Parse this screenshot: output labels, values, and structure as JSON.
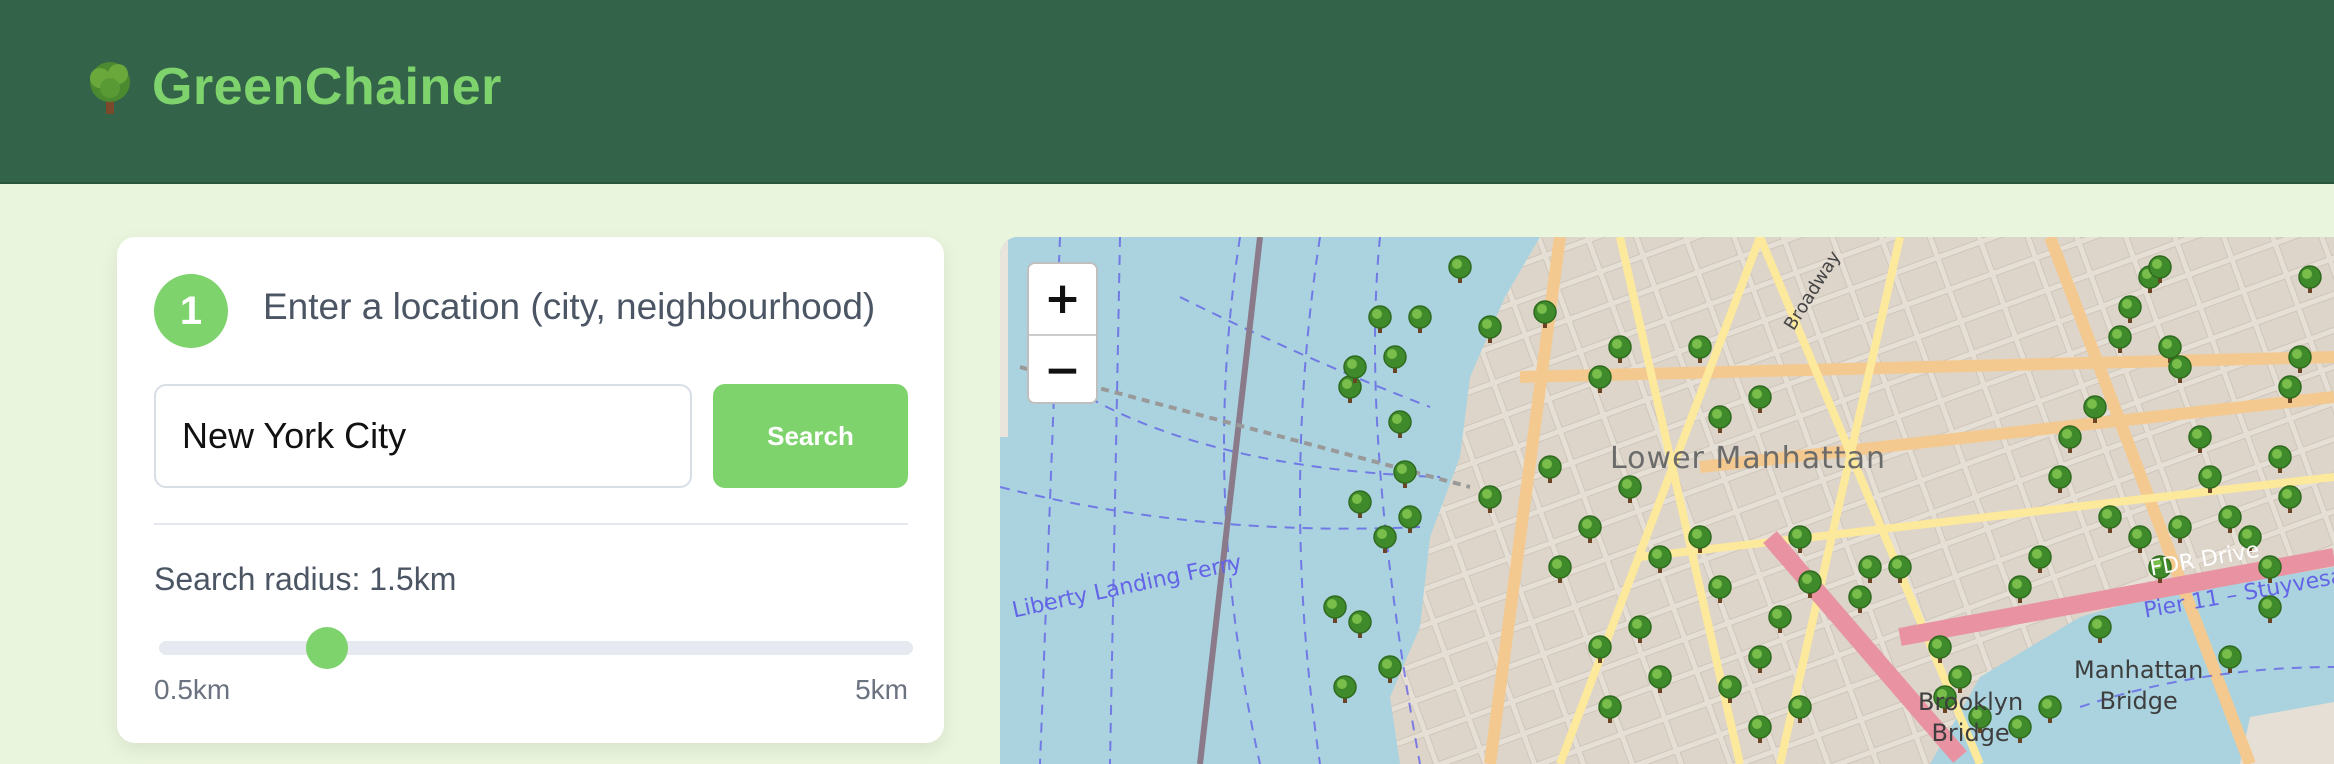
{
  "header": {
    "app_title": "GreenChainer",
    "logo_icon": "tree-icon"
  },
  "location_step": {
    "step_number": "1",
    "label": "Enter a location (city, neighbourhood)",
    "input_value": "New York City",
    "search_label": "Search"
  },
  "radius": {
    "label": "Search radius: 1.5km",
    "min_label": "0.5km",
    "max_label": "5km",
    "value_km": 1.5,
    "min_km": 0.5,
    "max_km": 5
  },
  "map": {
    "zoom_in_label": "+",
    "zoom_out_label": "−",
    "labels": {
      "district": "Lower Manhattan",
      "ferry": "Liberty Landing Ferry",
      "brooklyn_bridge": "Brooklyn\nBridge",
      "manhattan_bridge": "Manhattan\nBridge",
      "fdr": "FDR Drive",
      "pier": "Pier 11 – Stuyvesa",
      "broadway": "Broadway"
    },
    "marker_icon": "tree-icon"
  },
  "colors": {
    "header_bg": "#336349",
    "accent": "#7ed36d",
    "page_bg": "#eaf5dd",
    "water": "#aad3df",
    "land": "#f2efe9"
  }
}
